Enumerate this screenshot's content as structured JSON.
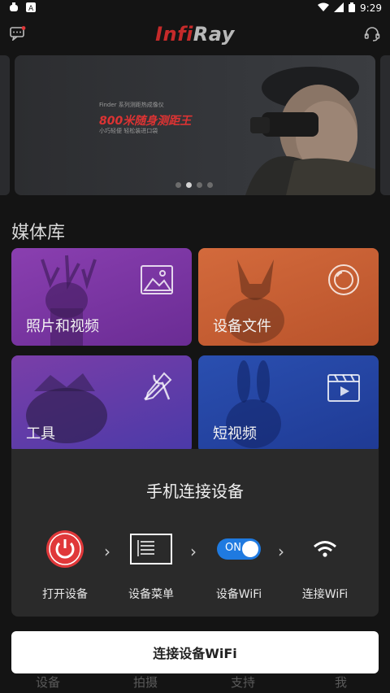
{
  "status_bar": {
    "left_icons": [
      "bug-icon",
      "a-icon"
    ],
    "time": "9:29",
    "right_icons": [
      "wifi-icon",
      "signal-icon",
      "battery-icon"
    ]
  },
  "appbar": {
    "brand": "InfiRay",
    "left_icon": "message-icon",
    "right_icon": "headset-icon"
  },
  "banner": {
    "line1": "Finder 系列测距热成像仪",
    "line2": "800米随身测距王",
    "line3": "小巧轻便 轻松装进口袋",
    "dots": 4,
    "active_dot": 2
  },
  "media": {
    "title": "媒体库",
    "tiles": [
      {
        "label": "照片和视频",
        "icon": "image-icon"
      },
      {
        "label": "设备文件",
        "icon": "disc-icon"
      },
      {
        "label": "工具",
        "icon": "tools-icon"
      },
      {
        "label": "短视频",
        "icon": "video-icon"
      }
    ]
  },
  "connect_sheet": {
    "title": "手机连接设备",
    "steps": [
      {
        "label": "打开设备",
        "icon": "power-icon"
      },
      {
        "label": "设备菜单",
        "icon": "menu-screen-icon"
      },
      {
        "label": "设备WiFi",
        "icon": "toggle-on-icon",
        "toggle_text": "ON"
      },
      {
        "label": "连接WiFi",
        "icon": "wifi-icon"
      }
    ]
  },
  "connect_button": {
    "label": "连接设备WiFi"
  },
  "bottom_nav": [
    "设备",
    "拍摄",
    "支持",
    "我"
  ],
  "colors": {
    "brand_red": "#c52a2a",
    "power_red": "#e0383a",
    "toggle_blue": "#1f7ae0"
  }
}
